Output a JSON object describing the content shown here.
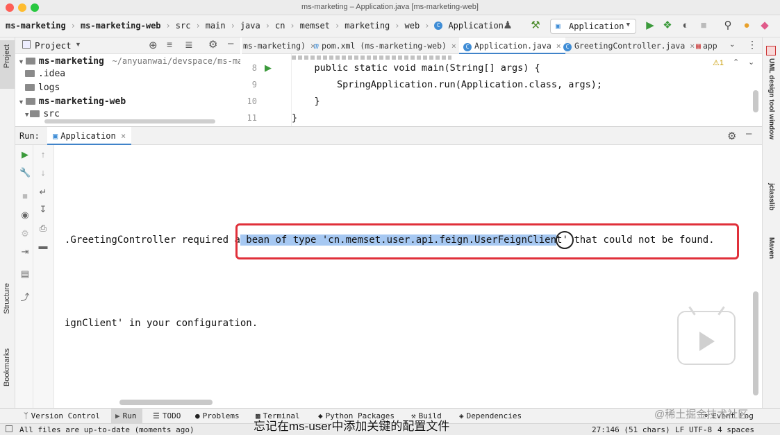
{
  "window": {
    "title": "ms-marketing – Application.java [ms-marketing-web]"
  },
  "breadcrumbs": [
    "ms-marketing",
    "ms-marketing-web",
    "src",
    "main",
    "java",
    "cn",
    "memset",
    "marketing",
    "web",
    "Application"
  ],
  "toolbar": {
    "run_config": "Application"
  },
  "left_strip": {
    "project": "Project",
    "structure": "Structure",
    "bookmarks": "Bookmarks"
  },
  "right_strip": {
    "uml": "UML design tool window",
    "jclasslib": "jclasslib",
    "maven": "Maven"
  },
  "project_panel": {
    "title": "Project",
    "tree": [
      {
        "label": "ms-marketing",
        "path": "~/anyuanwai/devspace/ms-ma"
      },
      {
        "label": ".idea"
      },
      {
        "label": "logs"
      },
      {
        "label": "ms-marketing-web"
      },
      {
        "label": "src"
      }
    ]
  },
  "editor_tabs": [
    {
      "label": "ms-marketing)"
    },
    {
      "label": "pom.xml (ms-marketing-web)"
    },
    {
      "label": "Application.java"
    },
    {
      "label": "GreetingController.java"
    },
    {
      "label": "app"
    }
  ],
  "editor": {
    "warning_count": "⚠1",
    "lines": [
      {
        "num": "8",
        "text": "    public static void main(String[] args) {"
      },
      {
        "num": "9",
        "text": "        SpringApplication.run(Application.class, args);"
      },
      {
        "num": "10",
        "text": "    }"
      },
      {
        "num": "11",
        "text": "}"
      }
    ]
  },
  "run_panel": {
    "label": "Run:",
    "tab": "Application",
    "console": {
      "line1_pre": ".GreetingController required ",
      "line1_a": "a",
      "line1_hl": " bean of type 'cn.memset.user.api.feign.UserFeignClien",
      "line1_post": "t'",
      "line1_tail": " that could not be found.",
      "line2": "ignClient' in your configuration."
    }
  },
  "bottom_tabs": [
    {
      "label": "Version Control"
    },
    {
      "label": "Run"
    },
    {
      "label": "TODO"
    },
    {
      "label": "Problems"
    },
    {
      "label": "Terminal"
    },
    {
      "label": "Python Packages"
    },
    {
      "label": "Build"
    },
    {
      "label": "Dependencies"
    },
    {
      "label": "Event Log"
    }
  ],
  "status": {
    "message": "All files are up-to-date (moments ago)",
    "position": "27:146 (51 chars)",
    "line_sep": "LF",
    "encoding": "UTF-8",
    "indent": "4 spaces"
  },
  "overlay": {
    "subtitle": "忘记在ms-user中添加关键的配置文件",
    "watermark": "@稀土掘金技术社区"
  },
  "colors": {
    "highlight": "#a6c8f2",
    "annotation_box": "#e0303a",
    "accent": "#4083c9"
  }
}
